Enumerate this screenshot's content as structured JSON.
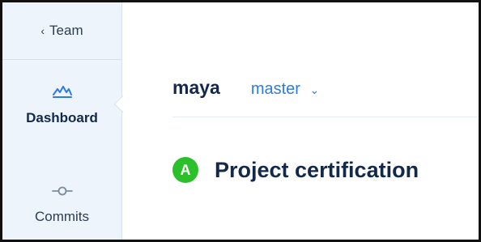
{
  "sidebar": {
    "back_label": "Team",
    "items": [
      {
        "label": "Dashboard",
        "icon": "dashboard-graph-icon",
        "active": true
      },
      {
        "label": "Commits",
        "icon": "commit-icon",
        "active": false
      }
    ]
  },
  "header": {
    "user": "maya",
    "branch": "master"
  },
  "certification": {
    "grade": "A",
    "title": "Project certification",
    "grade_color": "#2bc02b"
  },
  "colors": {
    "accent": "#2f7ae5",
    "sidebar_bg": "#eef4fb",
    "text_dark": "#13294b"
  }
}
